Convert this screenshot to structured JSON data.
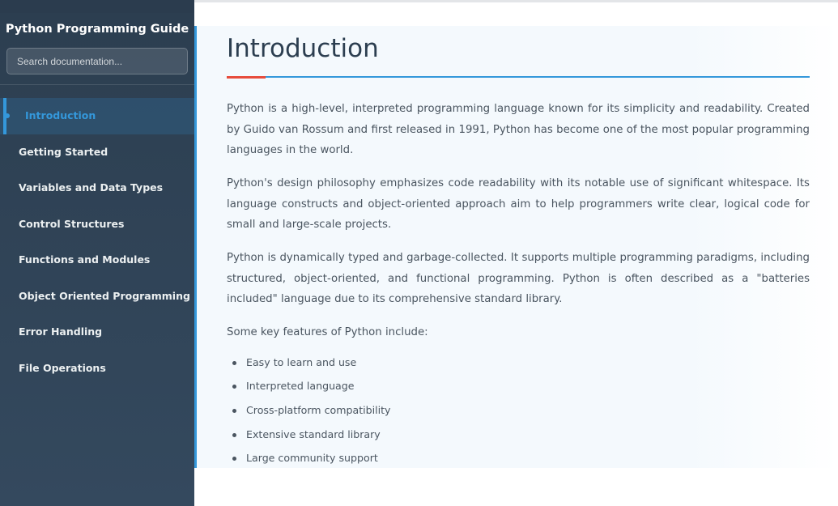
{
  "sidebar": {
    "title": "Python Programming Guide",
    "search": {
      "placeholder": "Search documentation..."
    },
    "items": [
      {
        "label": "Introduction",
        "active": true
      },
      {
        "label": "Getting Started"
      },
      {
        "label": "Variables and Data Types"
      },
      {
        "label": "Control Structures"
      },
      {
        "label": "Functions and Modules"
      },
      {
        "label": "Object Oriented Programming"
      },
      {
        "label": "Error Handling"
      },
      {
        "label": "File Operations"
      }
    ]
  },
  "main": {
    "title": "Introduction",
    "paragraphs": [
      "Python is a high-level, interpreted programming language known for its simplicity and readability. Created by Guido van Rossum and first released in 1991, Python has become one of the most popular programming languages in the world.",
      "Python's design philosophy emphasizes code readability with its notable use of significant whitespace. Its language constructs and object-oriented approach aim to help programmers write clear, logical code for small and large-scale projects.",
      "Python is dynamically typed and garbage-collected. It supports multiple programming paradigms, including structured, object-oriented, and functional programming. Python is often described as a \"batteries included\" language due to its comprehensive standard library.",
      "Some key features of Python include:"
    ],
    "features": [
      "Easy to learn and use",
      "Interpreted language",
      "Cross-platform compatibility",
      "Extensive standard library",
      "Large community support"
    ]
  },
  "colors": {
    "sidebar_bg": "#2c3e50",
    "accent_blue": "#3498db",
    "accent_red": "#e74c3c",
    "heading": "#2c3e50",
    "body_text": "#4a5560"
  }
}
